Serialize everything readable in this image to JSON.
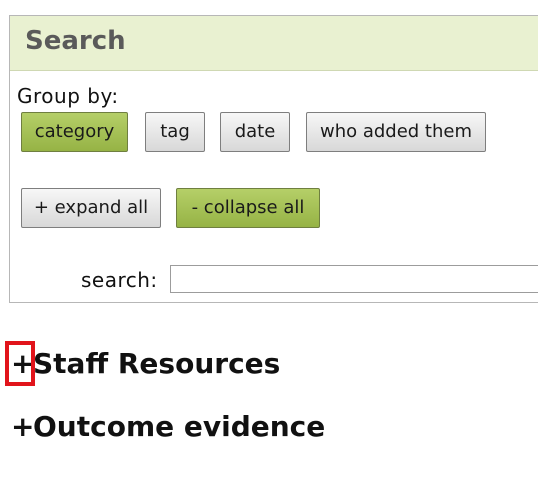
{
  "search_panel": {
    "title": "Search",
    "group_by_label": "Group by:",
    "group_buttons": [
      "category",
      "tag",
      "date",
      "who added them"
    ],
    "active_group": "category",
    "expand_all_label": "+ expand all",
    "collapse_all_label": "- collapse all",
    "search_label": "search:",
    "search_value": ""
  },
  "sections": [
    {
      "toggle": "+",
      "title": "Staff Resources"
    },
    {
      "toggle": "+",
      "title": "Outcome evidence"
    }
  ],
  "colors": {
    "header_bg": "#e9f1d1",
    "active_button": "#a7c257",
    "highlight_border": "#e1141b"
  }
}
